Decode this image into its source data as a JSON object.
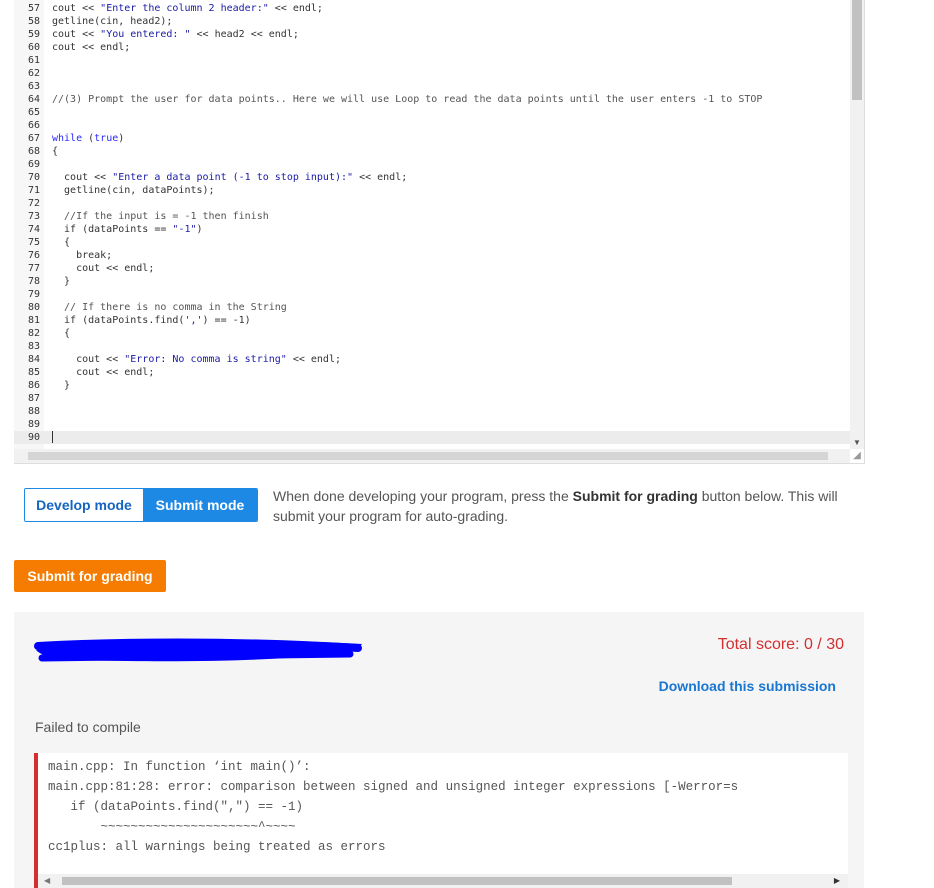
{
  "editor": {
    "lines": [
      {
        "n": "57",
        "code": "cout << \"Enter the column 2 header:\" << endl;"
      },
      {
        "n": "58",
        "code": "getline(cin, head2);"
      },
      {
        "n": "59",
        "code": "cout << \"You entered: \" << head2 << endl;"
      },
      {
        "n": "60",
        "code": "cout << endl;"
      },
      {
        "n": "61",
        "code": ""
      },
      {
        "n": "62",
        "code": ""
      },
      {
        "n": "63",
        "code": ""
      },
      {
        "n": "64",
        "code": "//(3) Prompt the user for data points.. Here we will use Loop to read the data points until the user enters -1 to STOP"
      },
      {
        "n": "65",
        "code": ""
      },
      {
        "n": "66",
        "code": ""
      },
      {
        "n": "67",
        "code": "while (true)"
      },
      {
        "n": "68",
        "code": "{"
      },
      {
        "n": "69",
        "code": ""
      },
      {
        "n": "70",
        "code": "  cout << \"Enter a data point (-1 to stop input):\" << endl;"
      },
      {
        "n": "71",
        "code": "  getline(cin, dataPoints);"
      },
      {
        "n": "72",
        "code": ""
      },
      {
        "n": "73",
        "code": "  //If the input is = -1 then finish"
      },
      {
        "n": "74",
        "code": "  if (dataPoints == \"-1\")"
      },
      {
        "n": "75",
        "code": "  {"
      },
      {
        "n": "76",
        "code": "    break;"
      },
      {
        "n": "77",
        "code": "    cout << endl;"
      },
      {
        "n": "78",
        "code": "  }"
      },
      {
        "n": "79",
        "code": ""
      },
      {
        "n": "80",
        "code": "  // If there is no comma in the String"
      },
      {
        "n": "81",
        "code": "  if (dataPoints.find(',') == -1)"
      },
      {
        "n": "82",
        "code": "  {"
      },
      {
        "n": "83",
        "code": ""
      },
      {
        "n": "84",
        "code": "    cout << \"Error: No comma is string\" << endl;"
      },
      {
        "n": "85",
        "code": "    cout << endl;"
      },
      {
        "n": "86",
        "code": "  }"
      },
      {
        "n": "87",
        "code": ""
      },
      {
        "n": "88",
        "code": ""
      },
      {
        "n": "89",
        "code": ""
      },
      {
        "n": "90",
        "code": ""
      }
    ]
  },
  "modes": {
    "develop_label": "Develop mode",
    "submit_label": "Submit mode",
    "active": "Submit mode"
  },
  "help": {
    "prefix": "When done developing your program, press the ",
    "button_ref": "Submit for grading",
    "suffix": " button below. This will submit your program for auto-grading."
  },
  "grade_button": {
    "label": "Submit for grading"
  },
  "results": {
    "total_score": "Total score: 0 / 30",
    "download_label": "Download this submission",
    "status": "Failed to compile",
    "console_lines": [
      "main.cpp: In function ‘int main()’:",
      "main.cpp:81:28: error: comparison between signed and unsigned integer expressions [-Werror=s",
      "   if (dataPoints.find(\",\") == -1)",
      "       ~~~~~~~~~~~~~~~~~~~~~^~~~~",
      "cc1plus: all warnings being treated as errors"
    ]
  },
  "colors": {
    "accent_blue": "#1e88e5",
    "submit_orange": "#f57c00",
    "error_red": "#d32f2f",
    "redaction_blue": "#0000ff"
  }
}
